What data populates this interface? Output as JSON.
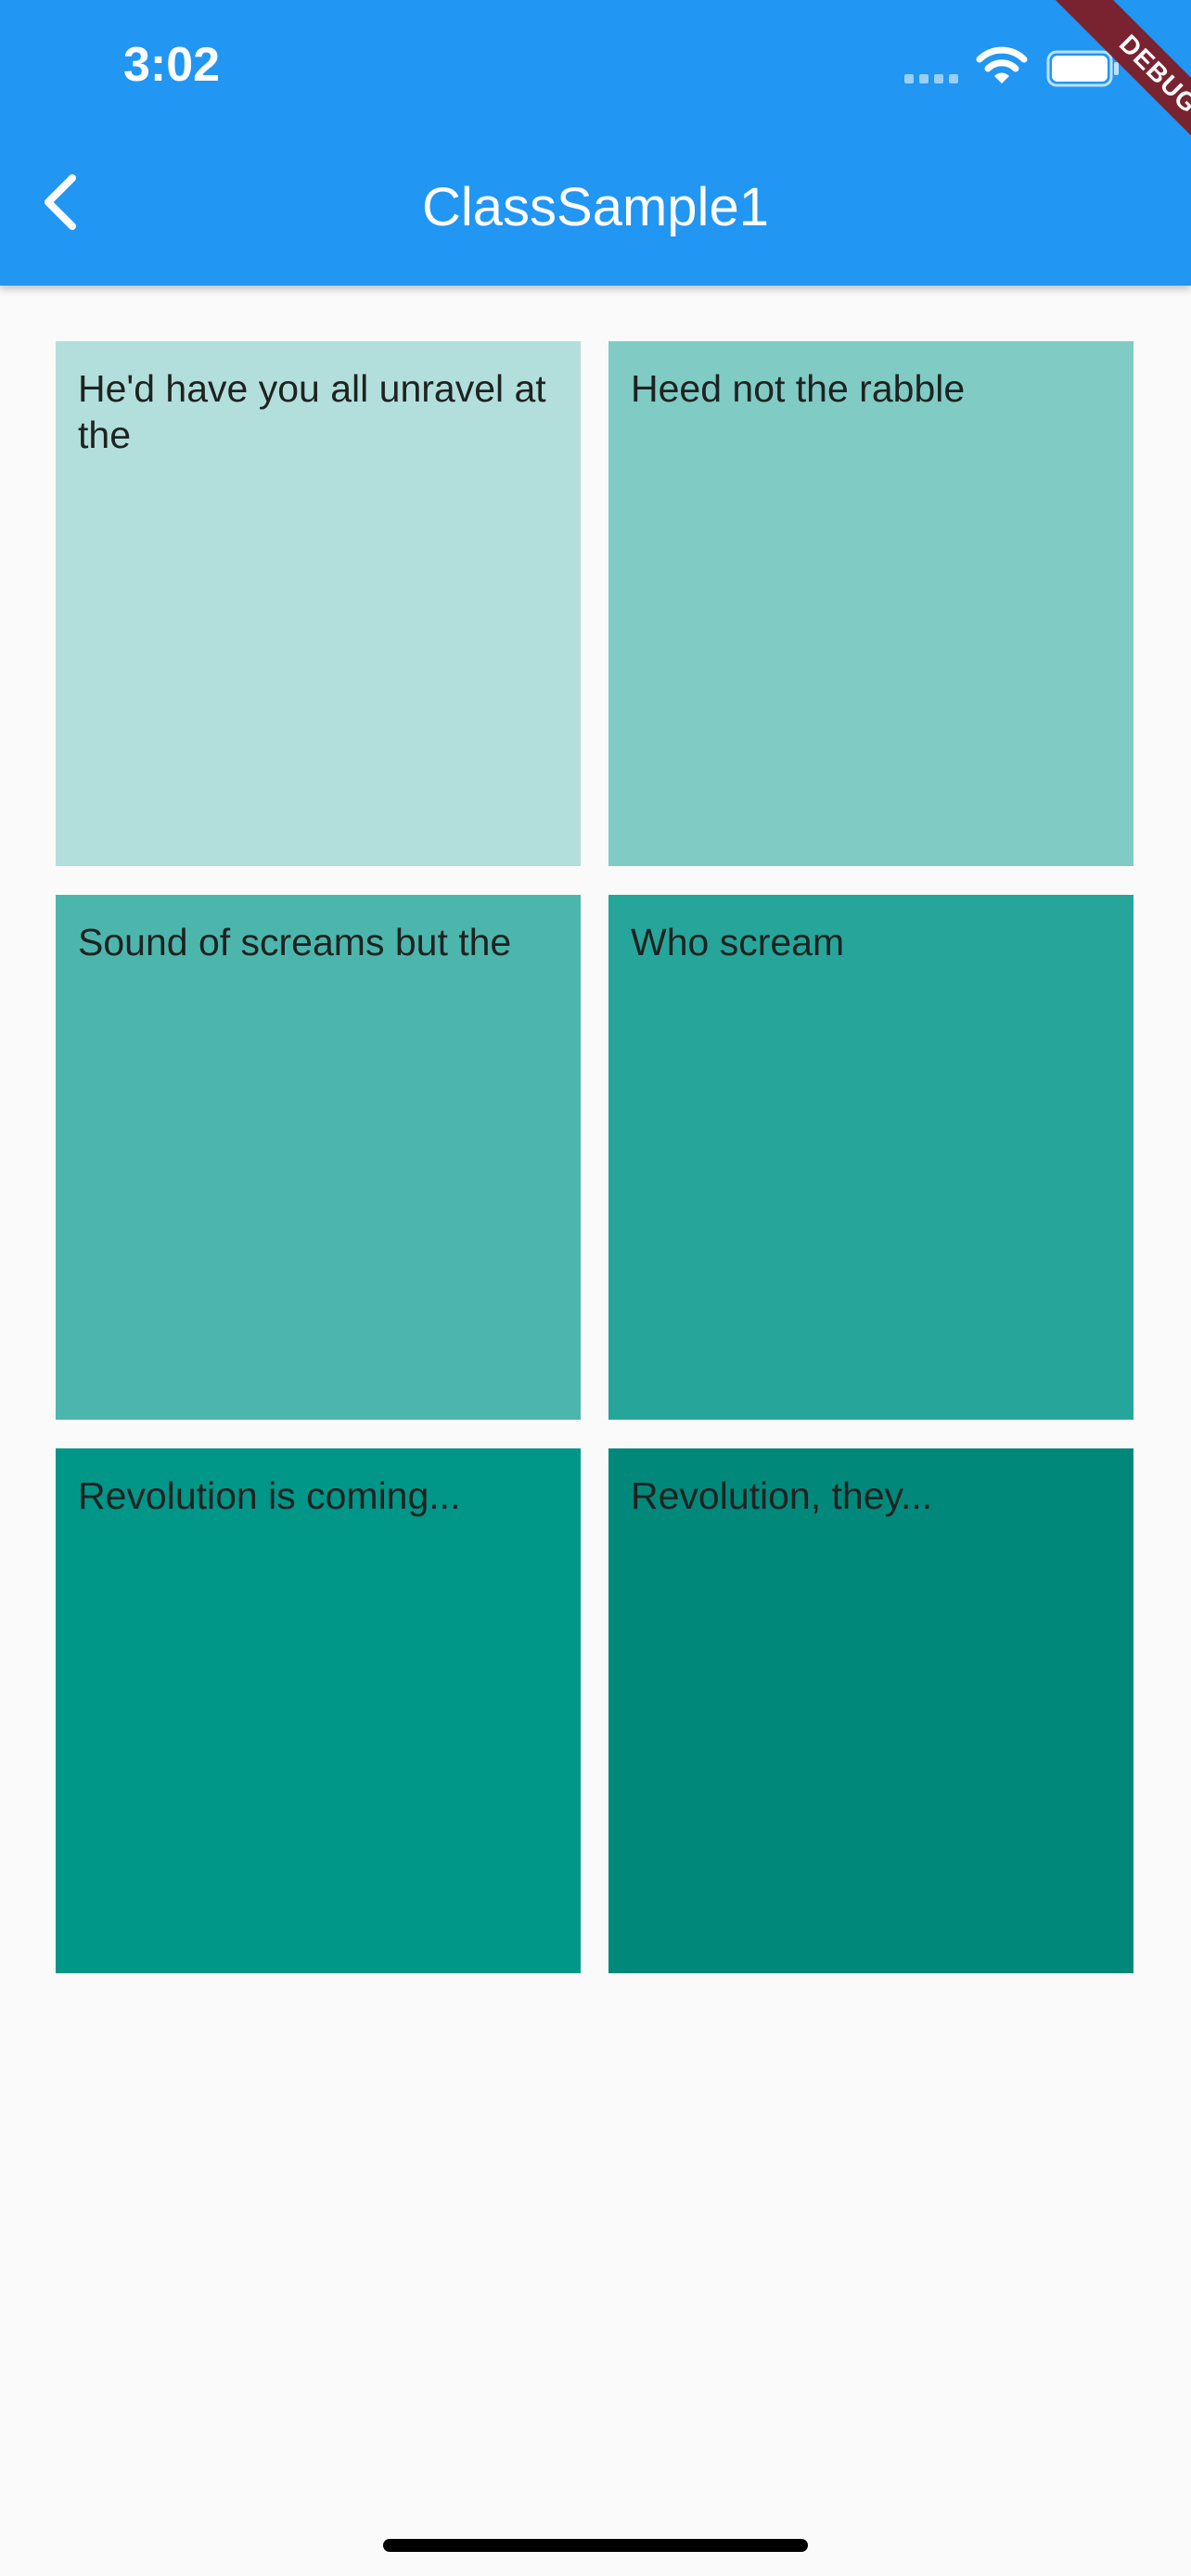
{
  "status_bar": {
    "time": "3:02",
    "icons": [
      "signal-dots-icon",
      "wifi-icon",
      "battery-icon"
    ]
  },
  "app_bar": {
    "title": "ClassSample1",
    "back_icon": "chevron-left-icon",
    "color": "#2196f3"
  },
  "debug_banner": {
    "label": "DEBUG",
    "color": "#7a2330"
  },
  "grid": {
    "tiles": [
      {
        "text": "He'd have you all unravel at the",
        "color": "#b2dfdb"
      },
      {
        "text": "Heed not the rabble",
        "color": "#80cbc4"
      },
      {
        "text": "Sound of screams but the",
        "color": "#4db6ac"
      },
      {
        "text": "Who scream",
        "color": "#26a69a"
      },
      {
        "text": "Revolution is coming...",
        "color": "#009688"
      },
      {
        "text": "Revolution, they...",
        "color": "#00897b"
      }
    ]
  }
}
